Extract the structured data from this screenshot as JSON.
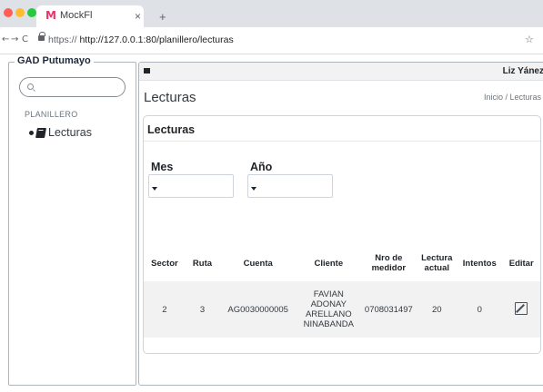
{
  "browser": {
    "tab_title": "MockFl",
    "tab_favicon": "M",
    "tab_close": "×",
    "tab_new": "+",
    "url_scheme": "https://",
    "url_path": "http://127.0.0.1:80/planillero/lecturas"
  },
  "sidebar": {
    "brand": "GAD Putumayo",
    "search_placeholder": "",
    "section_header": "PLANILLERO",
    "items": [
      {
        "label": "Lecturas",
        "icon": "book-icon"
      }
    ]
  },
  "topbar": {
    "user_name": "Liz Yánez"
  },
  "page": {
    "title": "Lecturas",
    "breadcrumb": "Inicio / Lecturas"
  },
  "card": {
    "title": "Lecturas",
    "filters": {
      "month_label": "Mes",
      "month_value": "",
      "year_label": "Año",
      "year_value": ""
    },
    "table": {
      "headers": [
        "Sector",
        "Ruta",
        "Cuenta",
        "Cliente",
        "Nro de medidor",
        "Lectura actual",
        "Intentos",
        "Editar"
      ],
      "rows": [
        {
          "sector": "2",
          "ruta": "3",
          "cuenta": "AG0030000005",
          "cliente_lines": [
            "FAVIAN",
            "ADONAY",
            "ARELLANO",
            "NINABANDA"
          ],
          "medidor": "0708031497",
          "lectura": "20",
          "intentos": "0",
          "edit_icon": "edit-icon"
        }
      ]
    }
  }
}
